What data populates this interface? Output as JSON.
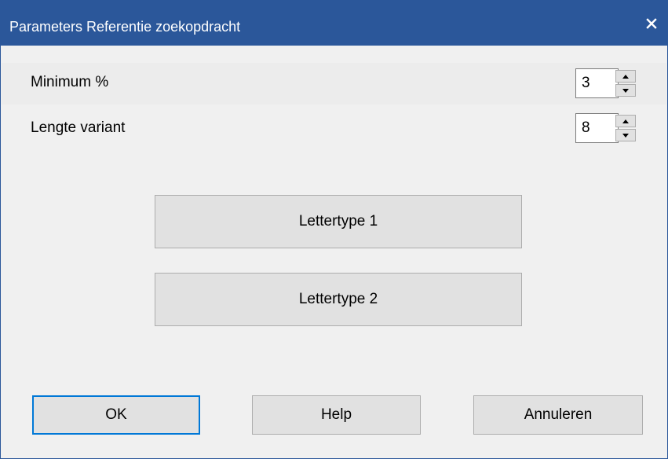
{
  "window": {
    "title": "Parameters Referentie zoekopdracht",
    "close_icon": "close-icon",
    "title_bar_color": "#2b579a"
  },
  "fields": {
    "minimum": {
      "label": "Minimum %",
      "value": "3"
    },
    "lengte": {
      "label": "Lengte variant",
      "value": "8"
    }
  },
  "font_buttons": {
    "font1": "Lettertype 1",
    "font2": "Lettertype 2"
  },
  "footer": {
    "ok": "OK",
    "help": "Help",
    "cancel": "Annuleren"
  }
}
